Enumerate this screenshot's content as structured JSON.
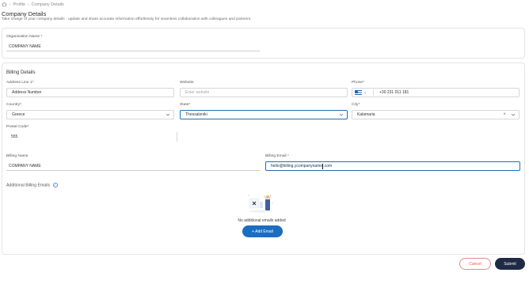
{
  "breadcrumb": {
    "items": [
      "Profile",
      "Company Details"
    ]
  },
  "page": {
    "title": "Company Details",
    "subtitle": "Take charge of your company details - update and share accurate information effortlessly for seamless collaboration with colleagues and partners."
  },
  "organization": {
    "label": "Organization Name",
    "required_mark": "*",
    "value": "COMPANY NAME"
  },
  "billing": {
    "section_title": "Billing Details",
    "address": {
      "label": "Address Line 1",
      "required_mark": "*",
      "value": "Address Number"
    },
    "website": {
      "label": "Website",
      "placeholder": "Enter website"
    },
    "phone": {
      "label": "Phone",
      "required_mark": "*",
      "value": "+30 231 011 181",
      "country_flag": "greece-flag"
    },
    "country": {
      "label": "Country",
      "required_mark": "*",
      "value": "Greece"
    },
    "state": {
      "label": "State",
      "required_mark": "*",
      "value": "Thessaloniki"
    },
    "city": {
      "label": "City",
      "required_mark": "*",
      "value": "Kalamaria"
    },
    "postal": {
      "label": "Postal Code",
      "required_mark": "*",
      "value": "555"
    },
    "billing_name": {
      "label": "Billing Name",
      "value": "COMPANY NAME"
    },
    "billing_email": {
      "label": "Billing Email",
      "required_mark": "*",
      "value_before_cursor": "hello@billing.ycompanyname",
      "value_after_cursor": ".com"
    },
    "additional_emails": {
      "label": "Additional Billing Emails",
      "empty_text": "No additional emails added",
      "add_button": "+ Add Email"
    }
  },
  "actions": {
    "cancel": "Cancel",
    "submit": "Submit"
  },
  "colors": {
    "primary": "#1a6ebf",
    "submit_bg": "#1f2a44",
    "cancel_border": "#e88a8a",
    "required": "#d32f2f",
    "focus": "#1f6fb5"
  }
}
